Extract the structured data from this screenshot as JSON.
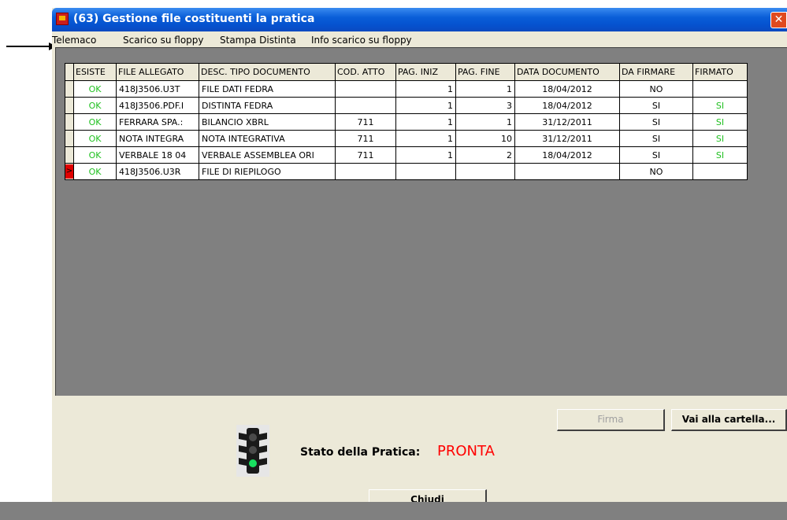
{
  "window": {
    "title": "(63) Gestione file costituenti la pratica",
    "close_glyph": "✕"
  },
  "menu": [
    "Telemaco",
    "Scarico su floppy",
    "Stampa Distinta",
    "Info scarico su floppy"
  ],
  "table": {
    "columns": [
      "ESISTE",
      "FILE ALLEGATO",
      "DESC. TIPO DOCUMENTO",
      "COD. ATTO",
      "PAG. INIZ",
      "PAG. FINE",
      "DATA DOCUMENTO",
      "DA FIRMARE",
      "FIRMATO"
    ],
    "rows": [
      {
        "esiste": "OK",
        "file": "418J3506.U3T",
        "desc": "FILE DATI FEDRA",
        "cod": "",
        "pag_iniz": "1",
        "pag_fine": "1",
        "data": "18/04/2012",
        "da_firmare": "NO",
        "firmato": ""
      },
      {
        "esiste": "OK",
        "file": "418J3506.PDF.I",
        "desc": "DISTINTA FEDRA",
        "cod": "",
        "pag_iniz": "1",
        "pag_fine": "3",
        "data": "18/04/2012",
        "da_firmare": "SI",
        "firmato": "SI"
      },
      {
        "esiste": "OK",
        "file": "FERRARA SPA.:",
        "desc": "BILANCIO XBRL",
        "cod": "711",
        "pag_iniz": "1",
        "pag_fine": "1",
        "data": "31/12/2011",
        "da_firmare": "SI",
        "firmato": "SI"
      },
      {
        "esiste": "OK",
        "file": "NOTA INTEGRA",
        "desc": "NOTA INTEGRATIVA",
        "cod": "711",
        "pag_iniz": "1",
        "pag_fine": "10",
        "data": "31/12/2011",
        "da_firmare": "SI",
        "firmato": "SI"
      },
      {
        "esiste": "OK",
        "file": "VERBALE 18 04",
        "desc": "VERBALE ASSEMBLEA ORI",
        "cod": "711",
        "pag_iniz": "1",
        "pag_fine": "2",
        "data": "18/04/2012",
        "da_firmare": "SI",
        "firmato": "SI"
      },
      {
        "esiste": "OK",
        "file": "418J3506.U3R",
        "desc": "FILE DI RIEPILOGO",
        "cod": "",
        "pag_iniz": "",
        "pag_fine": "",
        "data": "",
        "da_firmare": "NO",
        "firmato": ""
      }
    ],
    "current_row_indicator": ">"
  },
  "buttons": {
    "firma": "Firma",
    "vai": "Vai alla cartella...",
    "chiudi": "Chiudi"
  },
  "status": {
    "label": "Stato della Pratica:",
    "value": "PRONTA",
    "value_color": "#ff0000"
  },
  "colors": {
    "titlebar": "#0a5ed8",
    "ok_green": "#20c020",
    "grid_bg": "#808080"
  }
}
